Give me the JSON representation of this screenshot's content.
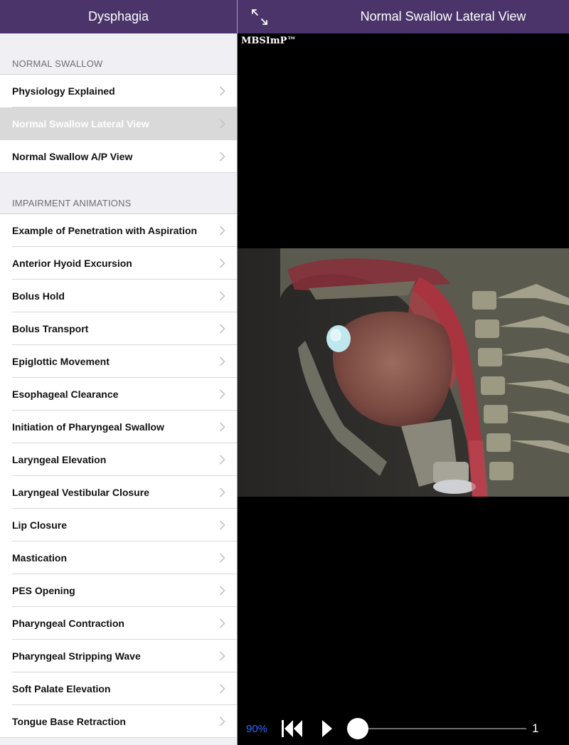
{
  "sidebar": {
    "title": "Dysphagia",
    "sections": [
      {
        "header": "NORMAL SWALLOW",
        "items": [
          {
            "label": "Physiology Explained"
          },
          {
            "label": "Normal Swallow Lateral View",
            "selected": true
          },
          {
            "label": "Normal Swallow A/P View"
          }
        ]
      },
      {
        "header": "IMPAIRMENT ANIMATIONS",
        "items": [
          {
            "label": "Example of Penetration with Aspiration"
          },
          {
            "label": "Anterior Hyoid Excursion"
          },
          {
            "label": "Bolus Hold"
          },
          {
            "label": "Bolus Transport"
          },
          {
            "label": "Epiglottic Movement"
          },
          {
            "label": "Esophageal Clearance"
          },
          {
            "label": "Initiation of Pharyngeal Swallow"
          },
          {
            "label": "Laryngeal Elevation"
          },
          {
            "label": "Laryngeal Vestibular Closure"
          },
          {
            "label": "Lip Closure"
          },
          {
            "label": "Mastication"
          },
          {
            "label": "PES Opening"
          },
          {
            "label": "Pharyngeal Contraction"
          },
          {
            "label": "Pharyngeal Stripping Wave"
          },
          {
            "label": "Soft Palate Elevation"
          },
          {
            "label": "Tongue Base Retraction"
          }
        ]
      }
    ]
  },
  "detail": {
    "title": "Normal Swallow Lateral View",
    "expand_icon": "expand-arrows-icon",
    "watermark": "MBSImP™",
    "image_subject": "lateral anatomical view of head and neck during swallow"
  },
  "player": {
    "speed": "90%",
    "rewind_icon": "skip-to-start-icon",
    "play_icon": "play-icon",
    "progress": 0.0,
    "frame": "1"
  },
  "colors": {
    "navbar": "#4a3469",
    "accent_blue": "#2f6bff",
    "selected_row": "#d9d9d9"
  }
}
